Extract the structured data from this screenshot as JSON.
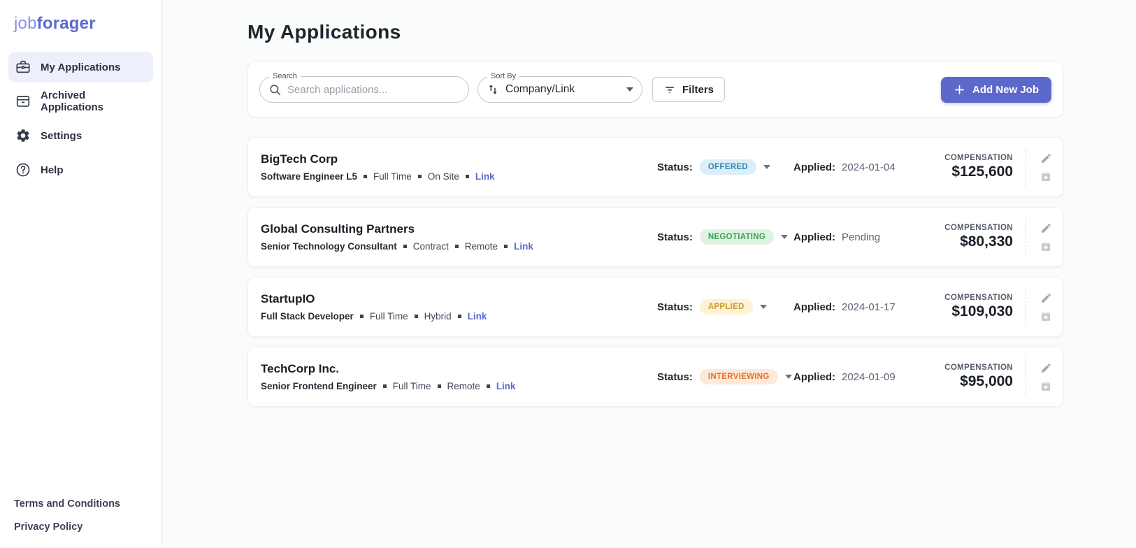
{
  "brand": {
    "prefix": "job",
    "suffix": "forager"
  },
  "sidebar": {
    "items": [
      {
        "label": "My Applications",
        "icon": "briefcase-icon",
        "active": true
      },
      {
        "label": "Archived Applications",
        "icon": "archive-icon",
        "active": false
      },
      {
        "label": "Settings",
        "icon": "gear-icon",
        "active": false
      },
      {
        "label": "Help",
        "icon": "help-icon",
        "active": false
      }
    ],
    "footer_links": {
      "terms": "Terms and Conditions",
      "privacy": "Privacy Policy"
    }
  },
  "header": {
    "title": "My Applications"
  },
  "toolbar": {
    "search": {
      "label": "Search",
      "placeholder": "Search applications..."
    },
    "sort": {
      "label": "Sort By",
      "value": "Company/Link"
    },
    "filters_label": "Filters",
    "add_button_label": "Add New Job"
  },
  "labels": {
    "status": "Status:",
    "applied": "Applied:",
    "compensation": "COMPENSATION"
  },
  "colors": {
    "accent": "#5d68cb",
    "sidebar_active_bg": "#edeffb",
    "status_offered": {
      "bg": "#dceef7",
      "text": "#2e86ba"
    },
    "status_negotiating": {
      "bg": "#def3e2",
      "text": "#3f9e53"
    },
    "status_applied": {
      "bg": "#fdf2d3",
      "text": "#cf9b26"
    },
    "status_interviewing": {
      "bg": "#fcead9",
      "text": "#e4702e"
    }
  },
  "applications": [
    {
      "company": "BigTech Corp",
      "role": "Software Engineer L5",
      "employment_type": "Full Time",
      "location_type": "On Site",
      "link_label": "Link",
      "status": "OFFERED",
      "status_bg": "#dceef7",
      "status_color": "#2e86ba",
      "applied": "2024-01-04",
      "compensation": "$125,600"
    },
    {
      "company": "Global Consulting Partners",
      "role": "Senior Technology Consultant",
      "employment_type": "Contract",
      "location_type": "Remote",
      "link_label": "Link",
      "status": "NEGOTIATING",
      "status_bg": "#def3e2",
      "status_color": "#3f9e53",
      "applied": "Pending",
      "compensation": "$80,330"
    },
    {
      "company": "StartupIO",
      "role": "Full Stack Developer",
      "employment_type": "Full Time",
      "location_type": "Hybrid",
      "link_label": "Link",
      "status": "APPLIED",
      "status_bg": "#fdf2d3",
      "status_color": "#cf9b26",
      "applied": "2024-01-17",
      "compensation": "$109,030"
    },
    {
      "company": "TechCorp Inc.",
      "role": "Senior Frontend Engineer",
      "employment_type": "Full Time",
      "location_type": "Remote",
      "link_label": "Link",
      "status": "INTERVIEWING",
      "status_bg": "#fcead9",
      "status_color": "#e4702e",
      "applied": "2024-01-09",
      "compensation": "$95,000"
    }
  ]
}
